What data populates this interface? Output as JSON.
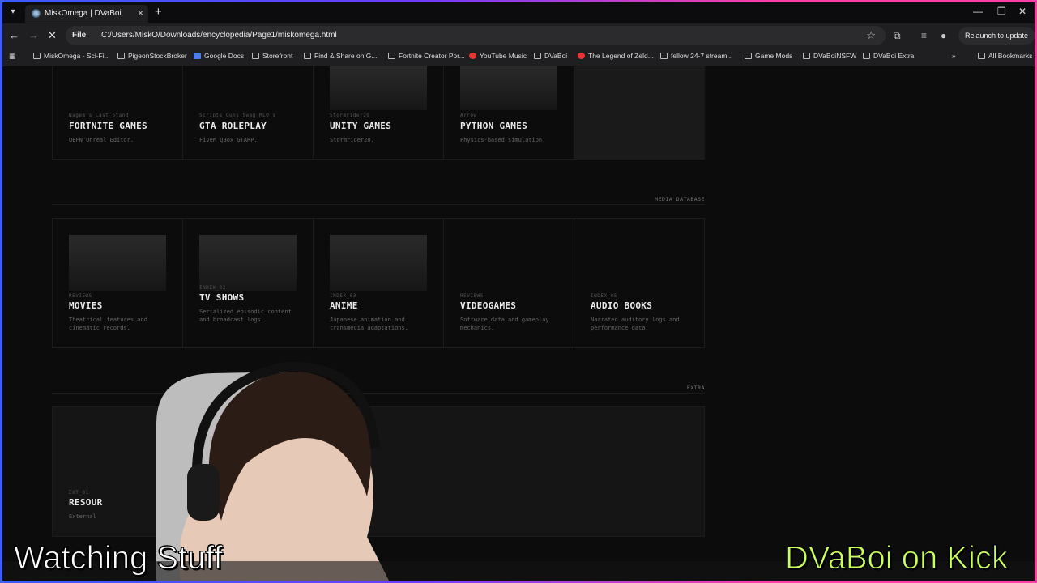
{
  "browser": {
    "tab_title": "MiskOmega | DVaBoi",
    "site_chip": "File",
    "url": "C:/Users/MiskO/Downloads/encyclopedia/Page1/miskomega.html",
    "relaunch_label": "Relaunch to update",
    "bookmarks": [
      {
        "label": "MiskOmega - Sci-Fi...",
        "icon": "page-icon"
      },
      {
        "label": "PigeonStockBroker",
        "icon": "folder-icon"
      },
      {
        "label": "Google Docs",
        "icon": "docs-icon"
      },
      {
        "label": "Storefront",
        "icon": "folder-icon"
      },
      {
        "label": "Find & Share on G...",
        "icon": "page-icon"
      },
      {
        "label": "Fortnite Creator Por...",
        "icon": "page-icon"
      },
      {
        "label": "YouTube Music",
        "icon": "youtube-icon"
      },
      {
        "label": "DVaBoi",
        "icon": "folder-icon"
      },
      {
        "label": "The Legend of Zeld...",
        "icon": "youtube-icon"
      },
      {
        "label": "fellow 24-7 stream...",
        "icon": "folder-icon"
      },
      {
        "label": "Game Mods",
        "icon": "folder-icon"
      },
      {
        "label": "DVaBoiNSFW",
        "icon": "folder-icon"
      },
      {
        "label": "DVaBoi Extra",
        "icon": "folder-icon"
      },
      {
        "label": "All Bookmarks",
        "icon": "folder-icon"
      }
    ]
  },
  "games": {
    "cards": [
      {
        "kicker": "Nagem's Last Stand",
        "title": "FORTNITE GAMES",
        "desc": "UEFN Unreal Editor."
      },
      {
        "kicker": "Scripts Guns Swag MLO's",
        "title": "GTA ROLEPLAY",
        "desc": "FiveM QBox GTARP."
      },
      {
        "kicker": "Stormrider20",
        "title": "UNITY GAMES",
        "desc": "Stormrider20."
      },
      {
        "kicker": "Arrow",
        "title": "PYTHON GAMES",
        "desc": "Physics-based simulation."
      }
    ]
  },
  "media": {
    "label": "MEDIA DATABASE",
    "cards": [
      {
        "kicker": "REVIEWS",
        "title": "MOVIES",
        "desc": "Theatrical features and cinematic records."
      },
      {
        "kicker": "INDEX_02",
        "title": "TV SHOWS",
        "desc": "Serialized episodic content and broadcast logs."
      },
      {
        "kicker": "INDEX_03",
        "title": "ANIME",
        "desc": "Japanese animation and transmedia adaptations."
      },
      {
        "kicker": "REVIEWS",
        "title": "VIDEOGAMES",
        "desc": "Software data and gameplay mechanics."
      },
      {
        "kicker": "INDEX_05",
        "title": "AUDIO BOOKS",
        "desc": "Narrated auditory logs and performance data."
      }
    ]
  },
  "extra": {
    "label": "EXTRA",
    "kicker": "EXT_01",
    "title": "RESOUR",
    "desc": "External"
  },
  "overlay": {
    "left_text": "Watching Stuff",
    "right_text": "DVaBoi on Kick"
  }
}
